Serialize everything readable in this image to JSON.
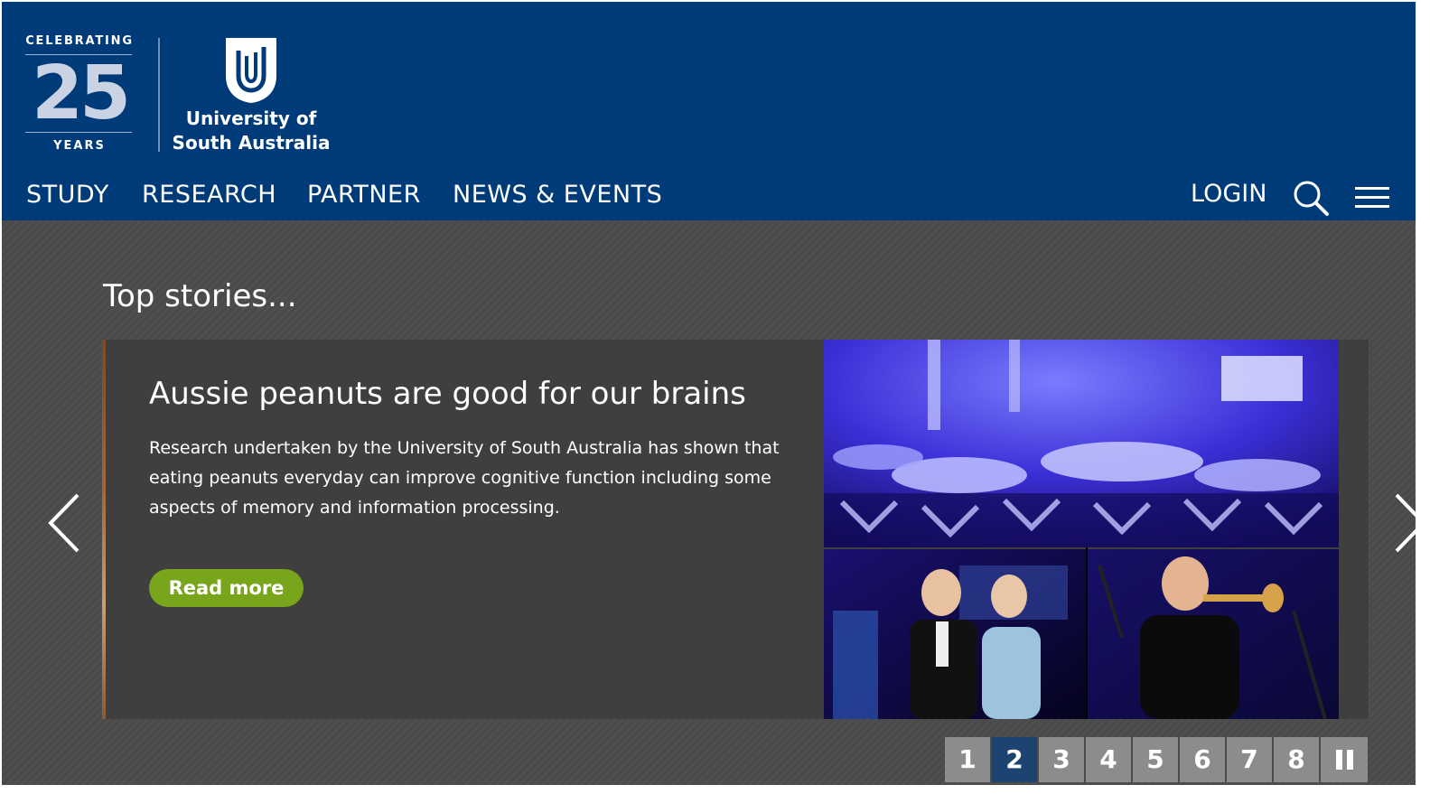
{
  "header": {
    "anniversary": {
      "top_text": "CELEBRATING",
      "number": "25",
      "bottom_text": "YEARS"
    },
    "university_name_line1": "University of",
    "university_name_line2": "South Australia",
    "nav": [
      "STUDY",
      "RESEARCH",
      "PARTNER",
      "NEWS & EVENTS"
    ],
    "login_label": "LOGIN",
    "icons": [
      "shield-logo-icon",
      "search-icon",
      "menu-icon"
    ],
    "colors": {
      "header_bg": "#003b79",
      "page_bg": "#4a4a4a",
      "accent_green": "#78a51c",
      "active_page": "#1d4370"
    }
  },
  "main": {
    "section_title": "Top stories...",
    "slide": {
      "title": "Aussie peanuts are good for our brains",
      "body": "Research undertaken by the University of South Australia has shown that eating peanuts everyday can improve cognitive function including some aspects of memory and information processing.",
      "button_label": "Read more"
    },
    "pager": {
      "pages": [
        "1",
        "2",
        "3",
        "4",
        "5",
        "6",
        "7",
        "8"
      ],
      "active_page": "2"
    },
    "icons": [
      "chevron-left-icon",
      "chevron-right-icon",
      "pause-icon"
    ]
  }
}
